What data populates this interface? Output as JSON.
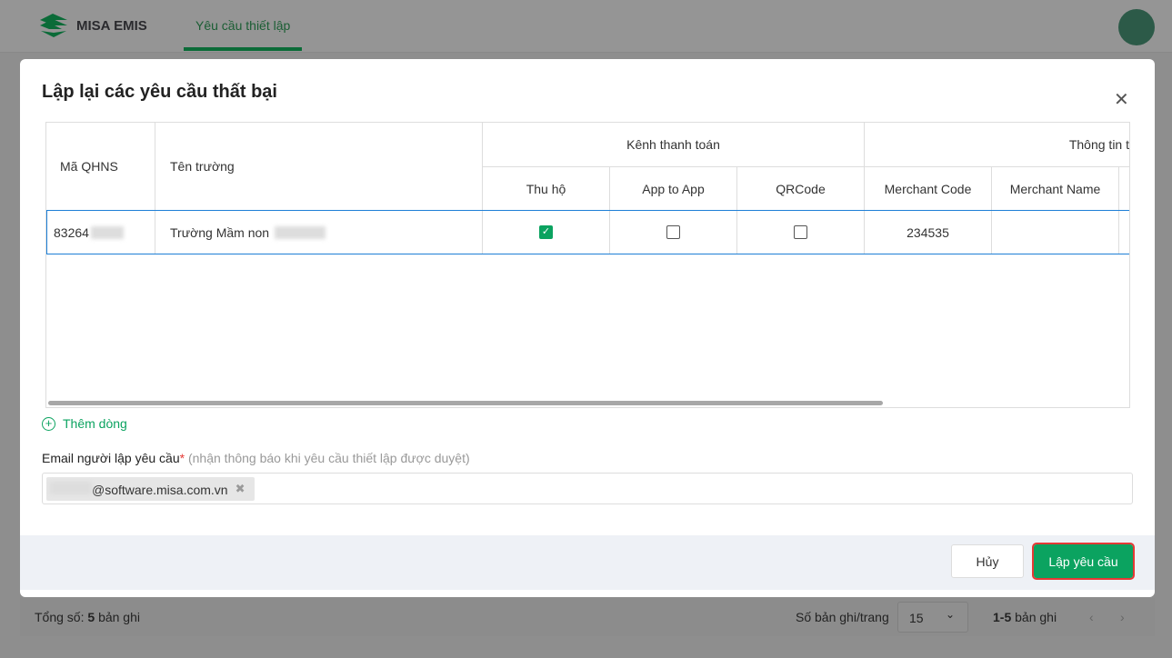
{
  "app": {
    "logo_text": "MISA EMIS",
    "nav_tab": "Yêu cầu thiết lập"
  },
  "pagebar": {
    "total_label": "Tổng số:",
    "total_value": "5",
    "total_unit": "bản ghi",
    "per_page_label": "Số bản ghi/trang",
    "per_page_value": "15",
    "range_value": "1-5",
    "range_unit": "bản ghi"
  },
  "modal": {
    "title": "Lập lại các yêu cầu thất bại",
    "table": {
      "headers": {
        "ma_qhns": "Mã QHNS",
        "ten_truong": "Tên trường",
        "kenh": "Kênh thanh toán",
        "thu_ho": "Thu hộ",
        "app_to_app": "App to App",
        "qrcode": "QRCode",
        "thong_tin": "Thông tin t",
        "merchant_code": "Merchant Code",
        "merchant_name": "Merchant Name"
      },
      "rows": [
        {
          "ma_qhns": "83264",
          "ten_truong": "Trường Mầm non ",
          "thu_ho": true,
          "app_to_app": false,
          "qrcode": false,
          "merchant_code": "234535",
          "merchant_name": ""
        }
      ]
    },
    "add_row": "Thêm dòng",
    "email_label": "Email người lập yêu cầu",
    "email_required": "*",
    "email_hint": "(nhận thông báo khi yêu cầu thiết lập được duyệt)",
    "email_value": "@software.misa.com.vn",
    "cancel": "Hủy",
    "submit": "Lập yêu cầu"
  }
}
